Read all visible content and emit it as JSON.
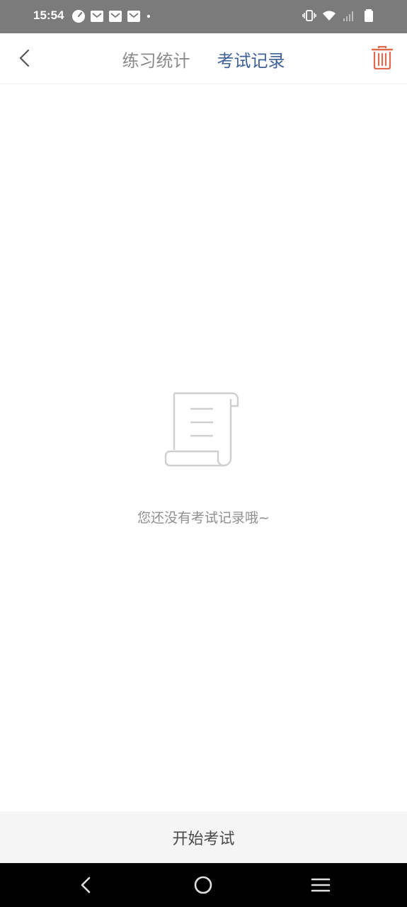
{
  "status_bar": {
    "time": "15:54",
    "left_icons": [
      "speedometer-icon",
      "mail-icon",
      "mail-icon",
      "mail-icon",
      "dot-icon"
    ],
    "right_icons": [
      "vibrate-icon",
      "wifi-icon",
      "signal-icon",
      "battery-icon"
    ]
  },
  "header": {
    "tabs": [
      {
        "label": "练习统计",
        "active": false
      },
      {
        "label": "考试记录",
        "active": true
      }
    ],
    "back_icon": "chevron-left-icon",
    "delete_icon": "trash-icon"
  },
  "empty_state": {
    "icon": "scroll-document-icon",
    "message": "您还没有考试记录哦~"
  },
  "footer": {
    "start_label": "开始考试"
  },
  "nav_bar": {
    "icons": [
      "nav-back-icon",
      "nav-home-icon",
      "nav-menu-icon"
    ]
  },
  "colors": {
    "status_bar_bg": "#7b7b7b",
    "active_tab": "#3f6097",
    "inactive_tab": "#8a8a8a",
    "trash_icon": "#e06a4e",
    "empty_text": "#8f8f8f",
    "footer_bg": "#f5f5f5"
  }
}
